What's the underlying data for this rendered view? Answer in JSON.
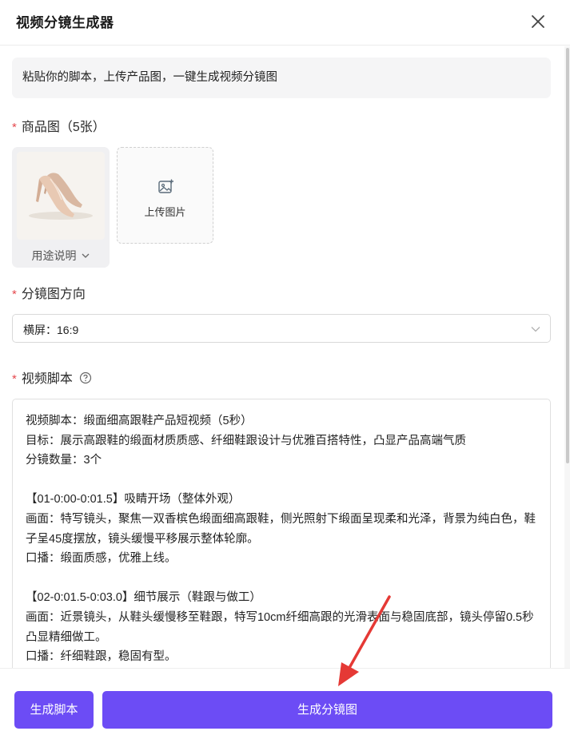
{
  "header": {
    "title": "视频分镜生成器",
    "close_icon": "close-icon"
  },
  "intro": "粘贴你的脚本，上传产品图，一键生成视频分镜图",
  "product_images": {
    "required_mark": "*",
    "label": "商品图（5张）",
    "items": [
      {
        "usage_label": "用途说明",
        "usage_icon": "chevron-down-icon"
      }
    ],
    "upload": {
      "label": "上传图片",
      "icon": "image-add-icon"
    }
  },
  "orientation": {
    "required_mark": "*",
    "label": "分镜图方向",
    "selected": "横屏：16:9",
    "icon": "chevron-down-icon"
  },
  "script": {
    "required_mark": "*",
    "label": "视频脚本",
    "help_icon": "question-circle-icon",
    "content": "视频脚本：缎面细高跟鞋产品短视频（5秒）\n目标：展示高跟鞋的缎面材质质感、纤细鞋跟设计与优雅百搭特性，凸显产品高端气质\n分镜数量：3个\n\n【01-0:00-0:01.5】吸睛开场（整体外观）\n画面：特写镜头，聚焦一双香槟色缎面细高跟鞋，侧光照射下缎面呈现柔和光泽，背景为纯白色，鞋子呈45度摆放，镜头缓慢平移展示整体轮廓。\n口播：缎面质感，优雅上线。\n\n【02-0:01.5-0:03.0】细节展示（鞋跟与做工）\n画面：近景镜头，从鞋头缓慢移至鞋跟，特写10cm纤细高跟的光滑表面与稳固底部，镜头停留0.5秒凸显精细做工。\n口播：纤细鞋跟，稳固有型。"
  },
  "footer": {
    "script_button": "生成脚本",
    "generate_button": "生成分镜图"
  },
  "colors": {
    "accent": "#6c4cf5",
    "required": "#e5484d"
  }
}
